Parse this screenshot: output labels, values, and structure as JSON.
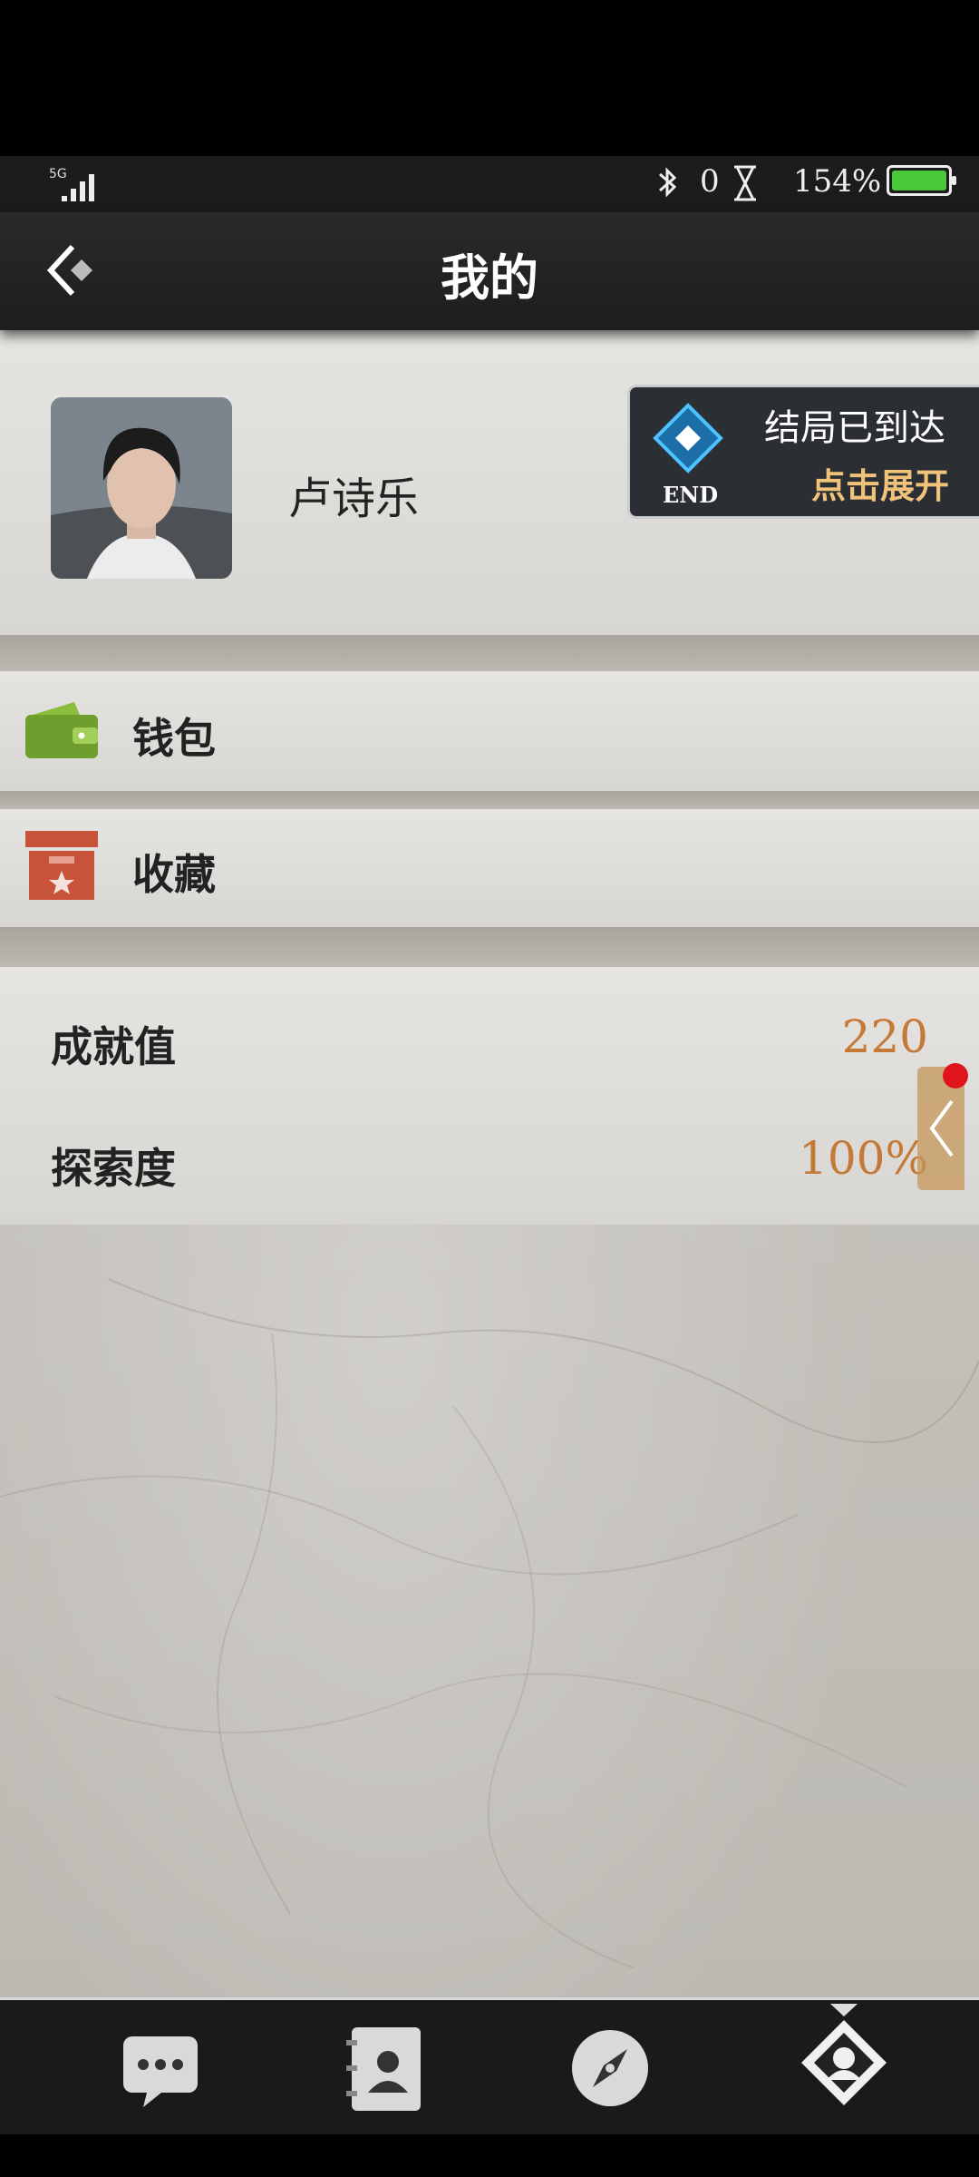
{
  "status_bar": {
    "network": "5G",
    "bluetooth_count": "0",
    "battery_percent": "154%",
    "icons": [
      "signal-icon",
      "bluetooth-icon",
      "hourglass-icon",
      "battery-icon"
    ]
  },
  "header": {
    "title": "我的",
    "back_icon": "back-arrow-icon"
  },
  "profile": {
    "name": "卢诗乐",
    "avatar": "avatar"
  },
  "end_badge": {
    "line1": "结局已到达",
    "line2": "点击展开",
    "icon_text": "END"
  },
  "menu": [
    {
      "label": "钱包",
      "icon": "wallet-icon",
      "color": "#6f9e2e"
    },
    {
      "label": "收藏",
      "icon": "favorites-box-icon",
      "color": "#c8533a"
    }
  ],
  "stats": [
    {
      "label": "成就值",
      "value": "220"
    },
    {
      "label": "探索度",
      "value": "100%"
    }
  ],
  "colors": {
    "accent_value": "#c47a36",
    "notification_dot": "#e0141e"
  },
  "bottom_nav": [
    {
      "name": "chat-icon"
    },
    {
      "name": "contacts-icon"
    },
    {
      "name": "compass-icon"
    },
    {
      "name": "profile-icon",
      "active": true
    }
  ]
}
